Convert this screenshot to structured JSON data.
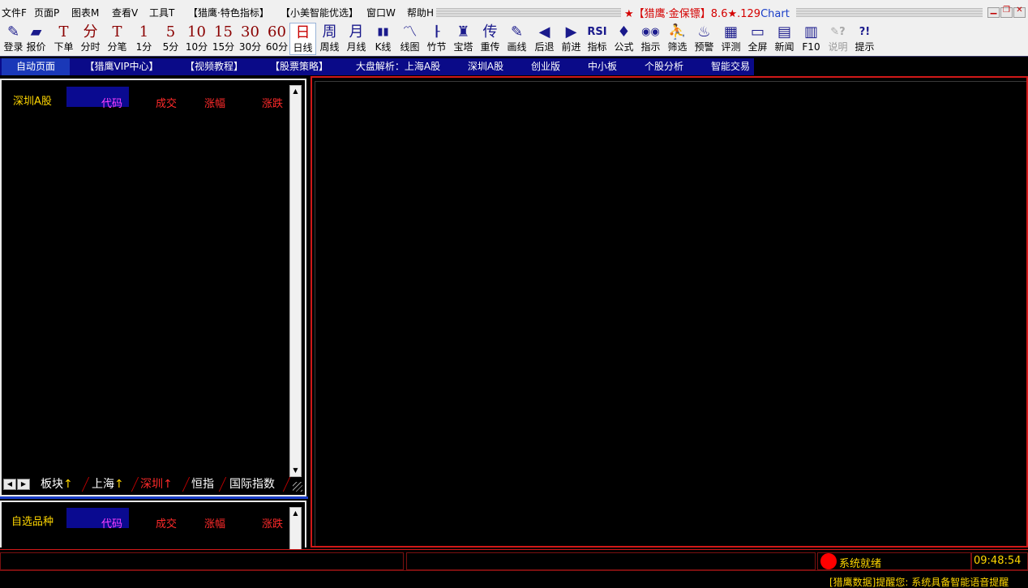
{
  "menu": {
    "items": [
      "文件F",
      "页面P",
      "图表M",
      "查看V",
      "工具T",
      "【猎鹰·特色指标】",
      "【小美智能优选】",
      "窗口W",
      "帮助H"
    ],
    "brand_prefix": "★【猎鹰·金保镖】8.6★.129",
    "brand_suffix": "Chart"
  },
  "window_buttons": {
    "minimize": "▁",
    "restore": "❐",
    "close": "✕"
  },
  "toolbar": {
    "buttons": [
      {
        "icon": "login-icon",
        "glyph": "✎",
        "label": "登录"
      },
      {
        "icon": "quote-icon",
        "glyph": "▰",
        "label": "报价"
      },
      {
        "icon": "order-icon",
        "glyph": "T",
        "label": "下单"
      },
      {
        "icon": "intraday-icon",
        "glyph": "分",
        "label": "分时"
      },
      {
        "icon": "tick-icon",
        "glyph": "T",
        "label": "分笔"
      },
      {
        "icon": "min1-icon",
        "glyph": "1",
        "label": "1分"
      },
      {
        "icon": "min5-icon",
        "glyph": "5",
        "label": "5分"
      },
      {
        "icon": "min10-icon",
        "glyph": "10",
        "label": "10分"
      },
      {
        "icon": "min15-icon",
        "glyph": "15",
        "label": "15分"
      },
      {
        "icon": "min30-icon",
        "glyph": "30",
        "label": "30分"
      },
      {
        "icon": "min60-icon",
        "glyph": "60",
        "label": "60分"
      },
      {
        "icon": "daily-icon",
        "glyph": "日",
        "label": "日线"
      },
      {
        "icon": "weekly-icon",
        "glyph": "周",
        "label": "周线"
      },
      {
        "icon": "monthly-icon",
        "glyph": "月",
        "label": "月线"
      },
      {
        "icon": "kline-icon",
        "glyph": "▮▮",
        "label": "K线"
      },
      {
        "icon": "line-chart-icon",
        "glyph": "〽",
        "label": "线图"
      },
      {
        "icon": "bamboo-icon",
        "glyph": "┠",
        "label": "竹节"
      },
      {
        "icon": "tower-icon",
        "glyph": "♜",
        "label": "宝塔"
      },
      {
        "icon": "legend-icon",
        "glyph": "传",
        "label": "重传"
      },
      {
        "icon": "draw-icon",
        "glyph": "✎",
        "label": "画线"
      },
      {
        "icon": "back-icon",
        "glyph": "◀",
        "label": "后退"
      },
      {
        "icon": "forward-icon",
        "glyph": "▶",
        "label": "前进"
      },
      {
        "icon": "indicator-icon",
        "glyph": "RSI",
        "label": "指标"
      },
      {
        "icon": "formula-icon",
        "glyph": "♦",
        "label": "公式"
      },
      {
        "icon": "instruct-icon",
        "glyph": "◉◉",
        "label": "指示"
      },
      {
        "icon": "filter-icon",
        "glyph": "⛹",
        "label": "筛选"
      },
      {
        "icon": "alert-icon",
        "glyph": "♨",
        "label": "预警"
      },
      {
        "icon": "evaluate-icon",
        "glyph": "▦",
        "label": "评测"
      },
      {
        "icon": "fullscreen-icon",
        "glyph": "▭",
        "label": "全屏"
      },
      {
        "icon": "news-icon",
        "glyph": "▤",
        "label": "新闻"
      },
      {
        "icon": "f10-icon",
        "glyph": "▥",
        "label": "F10"
      },
      {
        "icon": "help-doc-icon",
        "glyph": "✎?",
        "label": "说明"
      },
      {
        "icon": "tip-icon",
        "glyph": "?!",
        "label": "提示"
      }
    ]
  },
  "nav_tabs": [
    "自动页面",
    "【猎鹰VIP中心】",
    "【视频教程】",
    "【股票策略】",
    "大盘解析：上海A股",
    "深圳A股",
    "创业版",
    "中小板",
    "个股分析",
    "智能交易"
  ],
  "quote_panel": {
    "title": "深圳A股",
    "columns": [
      "代码",
      "成交",
      "涨幅",
      "涨跌"
    ],
    "tabs": [
      "板块",
      "上海",
      "深圳",
      "恒指",
      "国际指数"
    ],
    "up_arrow": "↑"
  },
  "watchlist_panel": {
    "title": "自选品种",
    "columns": [
      "代码",
      "成交",
      "涨幅",
      "涨跌"
    ]
  },
  "status": {
    "text": "系统就绪",
    "time": "09:48:54",
    "ticker": "[猎鹰数据]提醒您: 系统具备智能语音提醒"
  },
  "colors": {
    "accent_red": "#d01818",
    "nav_blue": "#0a0a88",
    "status_yellow": "#ffd700"
  }
}
